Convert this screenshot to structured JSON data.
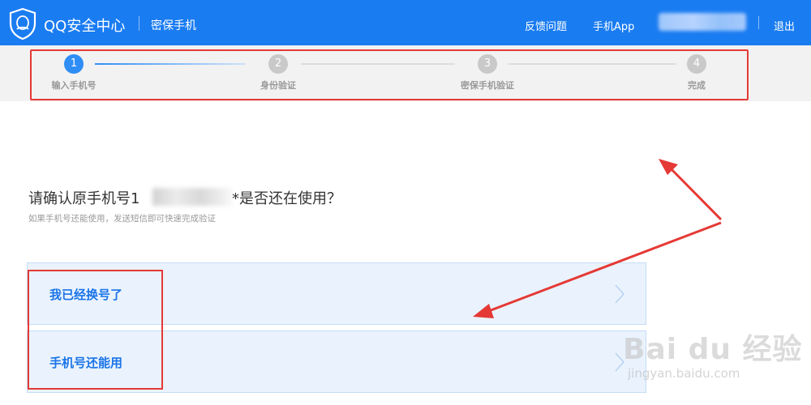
{
  "header": {
    "brand": "QQ安全中心",
    "subtitle": "密保手机",
    "nav": {
      "feedback": "反馈问题",
      "app": "手机App",
      "logout": "退出"
    },
    "colors": {
      "bar": "#1a7cf1"
    }
  },
  "steps": [
    {
      "number": "1",
      "label": "输入手机号",
      "state": "active"
    },
    {
      "number": "2",
      "label": "身份验证",
      "state": "pending"
    },
    {
      "number": "3",
      "label": "密保手机验证",
      "state": "pending"
    },
    {
      "number": "4",
      "label": "完成",
      "state": "pending"
    }
  ],
  "question": {
    "prefix": "请确认原手机号1",
    "suffix": "*是否还在使用？",
    "hint": "如果手机号还能使用，发送短信即可快速完成验证"
  },
  "options": [
    {
      "label": "我已经换号了"
    },
    {
      "label": "手机号还能用"
    }
  ],
  "watermark": {
    "brand": "Bai du 经验",
    "url": "jingyan.baidu.com"
  },
  "icons": {
    "logo": "qq-shield-icon",
    "chevron": "chevron-right-icon"
  }
}
